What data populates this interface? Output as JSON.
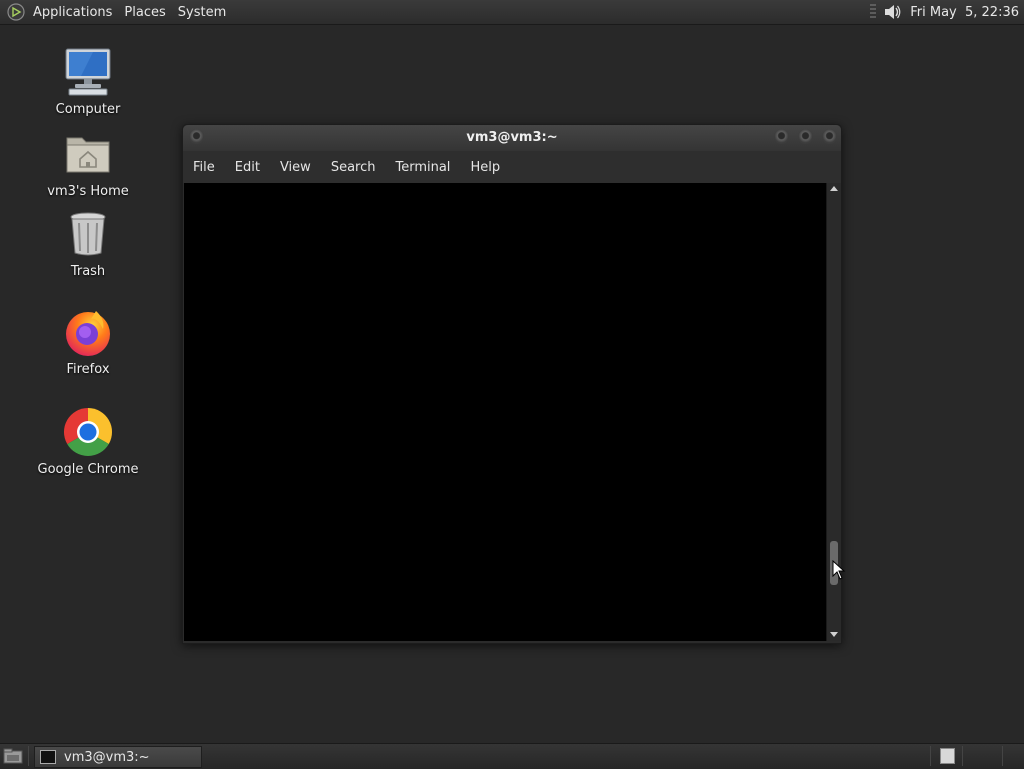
{
  "top_panel": {
    "applications": "Applications",
    "places": "Places",
    "system": "System",
    "clock": "Fri May  5, 22:36"
  },
  "desktop": {
    "icons": [
      {
        "label": "Computer",
        "icon": "computer-icon"
      },
      {
        "label": "vm3's Home",
        "icon": "home-folder-icon"
      },
      {
        "label": "Trash",
        "icon": "trash-icon"
      },
      {
        "label": "Firefox",
        "icon": "firefox-icon"
      },
      {
        "label": "Google Chrome",
        "icon": "chrome-icon"
      }
    ]
  },
  "terminal": {
    "title": "vm3@vm3:~",
    "menu": [
      "File",
      "Edit",
      "View",
      "Search",
      "Terminal",
      "Help"
    ]
  },
  "taskbar": {
    "task_label": "vm3@vm3:~"
  },
  "colors": {
    "desktop_bg": "#282828",
    "terminal_bg": "#000000",
    "panel_bg": "#2c2c2c"
  }
}
